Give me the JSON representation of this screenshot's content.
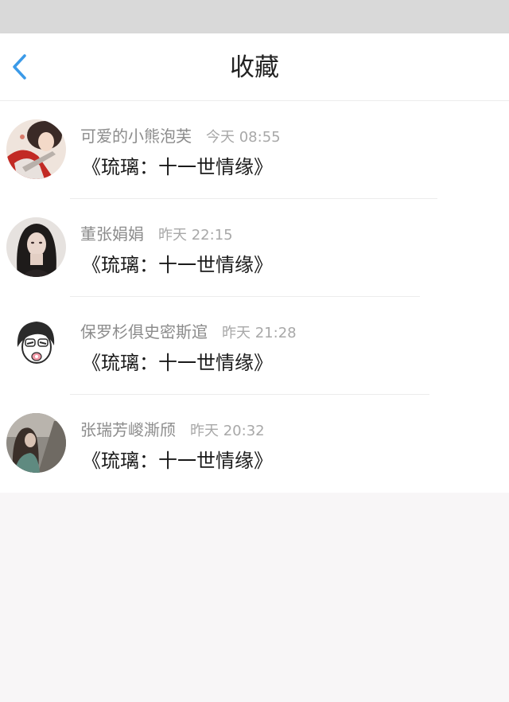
{
  "nav": {
    "title": "收藏",
    "back_icon": "chevron-left-icon",
    "accent_color": "#3b9ae8"
  },
  "items": [
    {
      "name": "可爱的小熊泡芙",
      "time": "今天 08:55",
      "title": "《琉璃：十一世情缘》",
      "avatar": "avatar-illustration"
    },
    {
      "name": "董张娟娟",
      "time": "昨天 22:15",
      "title": "《琉璃：十一世情缘》",
      "avatar": "avatar-photo"
    },
    {
      "name": "保罗杉俱史密斯逭",
      "time": "昨天 21:28",
      "title": "《琉璃：十一世情缘》",
      "avatar": "avatar-cartoon"
    },
    {
      "name": "张瑞芳嵕澌颀",
      "time": "昨天 20:32",
      "title": "《琉璃：十一世情缘》",
      "avatar": "avatar-photo"
    }
  ]
}
